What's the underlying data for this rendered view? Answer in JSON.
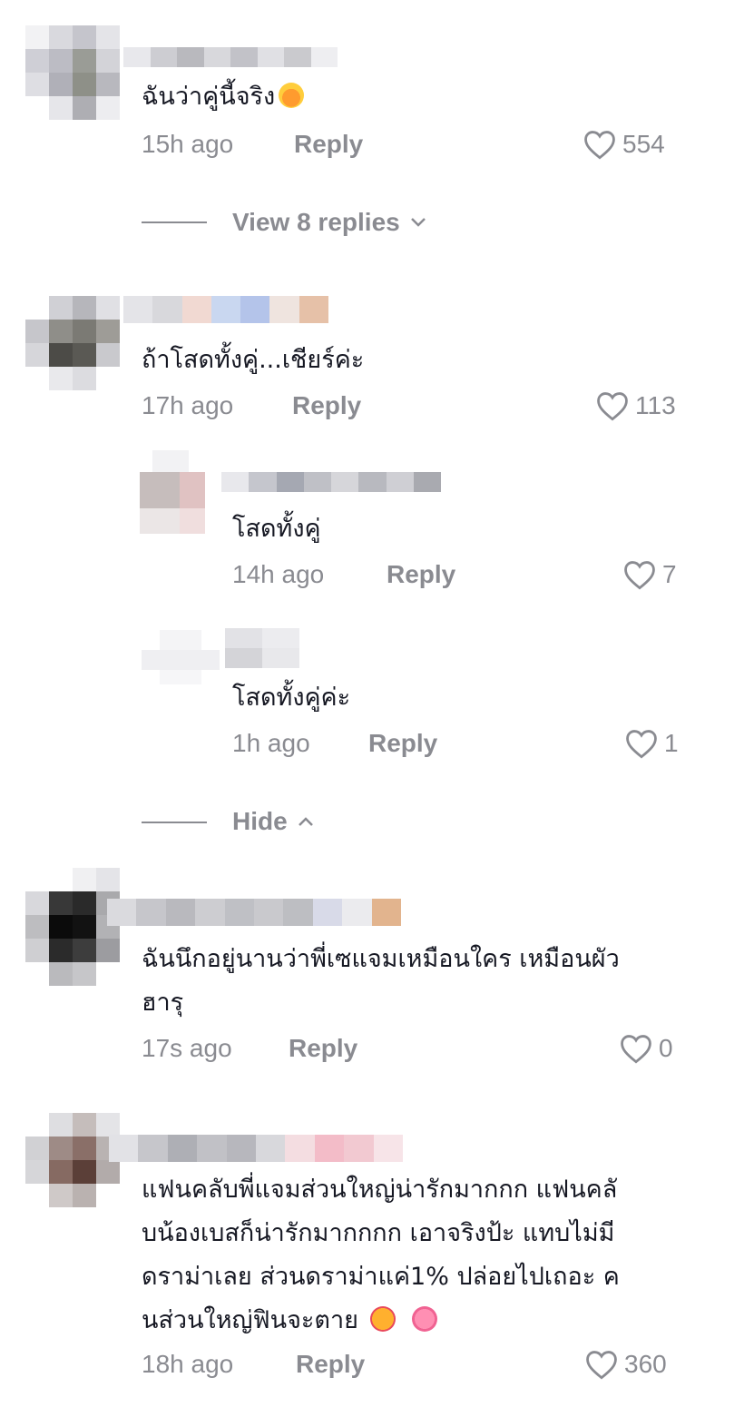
{
  "colors": {
    "text": "#161823",
    "muted": "#8a8b91",
    "background": "#ffffff"
  },
  "comments": [
    {
      "text": "ฉันว่าคู่นี้จริง",
      "emoji": "grinning-sweat-emoji",
      "time": "15h ago",
      "reply": "Reply",
      "likes": "554"
    },
    {
      "text": "ถ้าโสดทั้งคู่...เชียร์ค่ะ",
      "time": "17h ago",
      "reply": "Reply",
      "likes": "113",
      "replies": [
        {
          "text": "โสดทั้งคู่",
          "time": "14h ago",
          "reply": "Reply",
          "likes": "7"
        },
        {
          "text": "โสดทั้งคู่ค่ะ",
          "time": "1h ago",
          "reply": "Reply",
          "likes": "1"
        }
      ]
    },
    {
      "text": "ฉันนึกอยู่นานว่าพี่เซแจมเหมือนใคร เหมือนผัว",
      "text_line2": "ฮารุ",
      "time": "17s ago",
      "reply": "Reply",
      "likes": "0"
    },
    {
      "text": "แฟนคลับพี่แจมส่วนใหญ่น่ารักมากกก แฟนคลั",
      "text_line2": "บน้องเบสก็น่ารักมากกกก เอาจริงป้ะ แทบไม่มี",
      "text_line3": "ดราม่าเลย ส่วนดราม่าแค่1% ปล่อยไปเถอะ ค",
      "text_line4": "นส่วนใหญ่ฟินจะตาย",
      "time": "18h ago",
      "reply": "Reply",
      "likes": "360"
    }
  ],
  "threads": {
    "view_replies": "View 8 replies",
    "hide": "Hide"
  }
}
